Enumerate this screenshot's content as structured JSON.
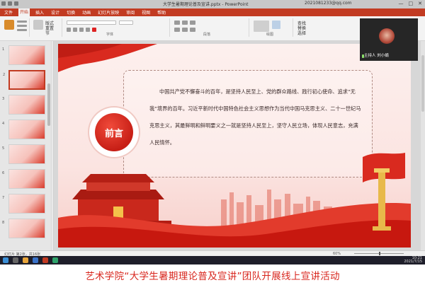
{
  "window": {
    "doc_title": "大学生暑期理论普及宣讲.pptx - PowerPoint",
    "user": "2021081233@qq.com",
    "controls": [
      "—",
      "□",
      "✕"
    ]
  },
  "ribbon_tabs": [
    "文件",
    "开始",
    "插入",
    "设计",
    "切换",
    "动画",
    "幻灯片放映",
    "审阅",
    "视图",
    "帮助"
  ],
  "active_tab": "开始",
  "ribbon": {
    "new_slide": "新建幻灯片",
    "layout": "版式",
    "reset": "重置",
    "section": "节",
    "font_group": "字体",
    "paragraph_group": "段落",
    "drawing_group": "绘图",
    "editing_group": "编辑",
    "find": "查找",
    "replace": "替换",
    "select": "选择"
  },
  "thumbnails": {
    "items": [
      {
        "n": "1"
      },
      {
        "n": "2"
      },
      {
        "n": "3"
      },
      {
        "n": "4"
      },
      {
        "n": "5"
      },
      {
        "n": "6"
      },
      {
        "n": "7"
      },
      {
        "n": "8"
      }
    ],
    "active_index": 1
  },
  "slide": {
    "badge_text": "前言",
    "body": "中国共产党不懈奋斗的百年，是坚持人民至上、党的群众路线、践行初心使命、追求“无我”境界的百年。习近平新时代中国特色社会主义思想作为当代中国马克思主义、二十一世纪马克思主义，其最鲜明和鲜明要义之一就是坚持人民至上，坚守人民立场，体现人民意志，充满人民情怀。"
  },
  "video": {
    "name": "主持人 刘小娟"
  },
  "status": {
    "slide_info": "幻灯片 第2张，共16张",
    "zoom": "60%"
  },
  "taskbar": {
    "time": "10:21",
    "date": "2021/7/15"
  },
  "caption": "艺术学院“大学生暑期理论普及宣讲”团队开展线上宣讲活动",
  "colors": {
    "accent": "#c23b22",
    "caption": "#d8261e"
  }
}
